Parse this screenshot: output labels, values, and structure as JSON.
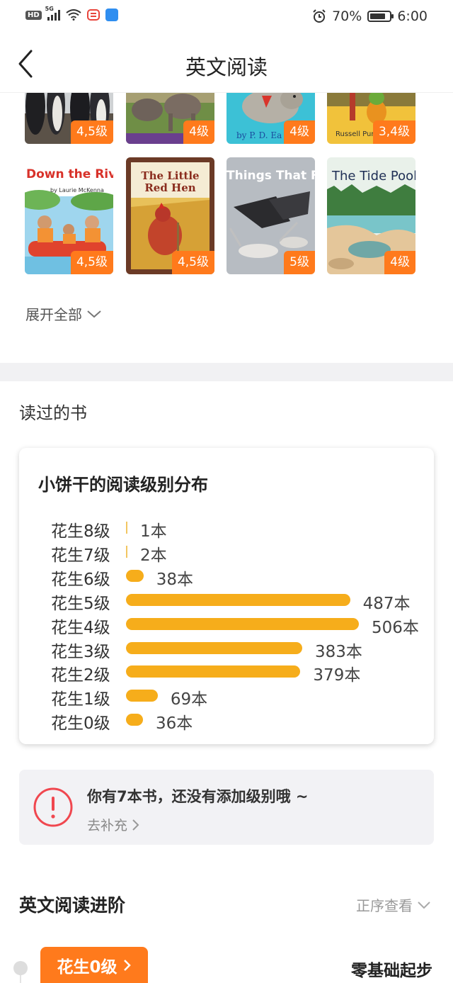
{
  "status_bar": {
    "hd_label": "HD",
    "network_label": "5G",
    "battery_percent": "70%",
    "time": "6:00"
  },
  "header": {
    "title": "英文阅读",
    "back_icon": "chevron-left-icon"
  },
  "books": [
    {
      "title": "",
      "level": "4,5级"
    },
    {
      "title": "",
      "level": "4级"
    },
    {
      "title": "by P. D. Ea",
      "level": "4级"
    },
    {
      "title": "Russell Punter",
      "level": "3,4级"
    },
    {
      "title": "Down the River",
      "subtitle": "by Laurie McKenna",
      "level": "4,5级"
    },
    {
      "title": "The Little Red Hen",
      "level": "4,5级"
    },
    {
      "title": "Things That Fly",
      "level": "5级"
    },
    {
      "title": "The Tide Pool",
      "level": "4级"
    }
  ],
  "expand_all": "展开全部",
  "read_books_heading": "读过的书",
  "distribution": {
    "title": "小饼干的阅读级别分布",
    "rows": [
      {
        "label": "花生8级",
        "count": "1本"
      },
      {
        "label": "花生7级",
        "count": "2本"
      },
      {
        "label": "花生6级",
        "count": "38本"
      },
      {
        "label": "花生5级",
        "count": "487本"
      },
      {
        "label": "花生4级",
        "count": "506本"
      },
      {
        "label": "花生3级",
        "count": "383本"
      },
      {
        "label": "花生2级",
        "count": "379本"
      },
      {
        "label": "花生1级",
        "count": "69本"
      },
      {
        "label": "花生0级",
        "count": "36本"
      }
    ]
  },
  "chart_data": {
    "type": "bar",
    "orientation": "horizontal",
    "title": "小饼干的阅读级别分布",
    "categories": [
      "花生8级",
      "花生7级",
      "花生6级",
      "花生5级",
      "花生4级",
      "花生3级",
      "花生2级",
      "花生1级",
      "花生0级"
    ],
    "values": [
      1,
      2,
      38,
      487,
      506,
      383,
      379,
      69,
      36
    ],
    "unit": "本",
    "bar_color": "#f6ad1b",
    "grid": false
  },
  "notice": {
    "text": "你有7本书，还没有添加级别哦 ~",
    "link": "去补充",
    "icon": "exclamation-circle-icon",
    "accent": "#f0474f"
  },
  "progression": {
    "title": "英文阅读进阶",
    "sort_label": "正序查看",
    "current_level": "花生0级",
    "current_level_desc": "零基础起步"
  },
  "colors": {
    "accent": "#ff7a1c",
    "bar": "#f6ad1b",
    "separator": "#f1f1f3"
  }
}
